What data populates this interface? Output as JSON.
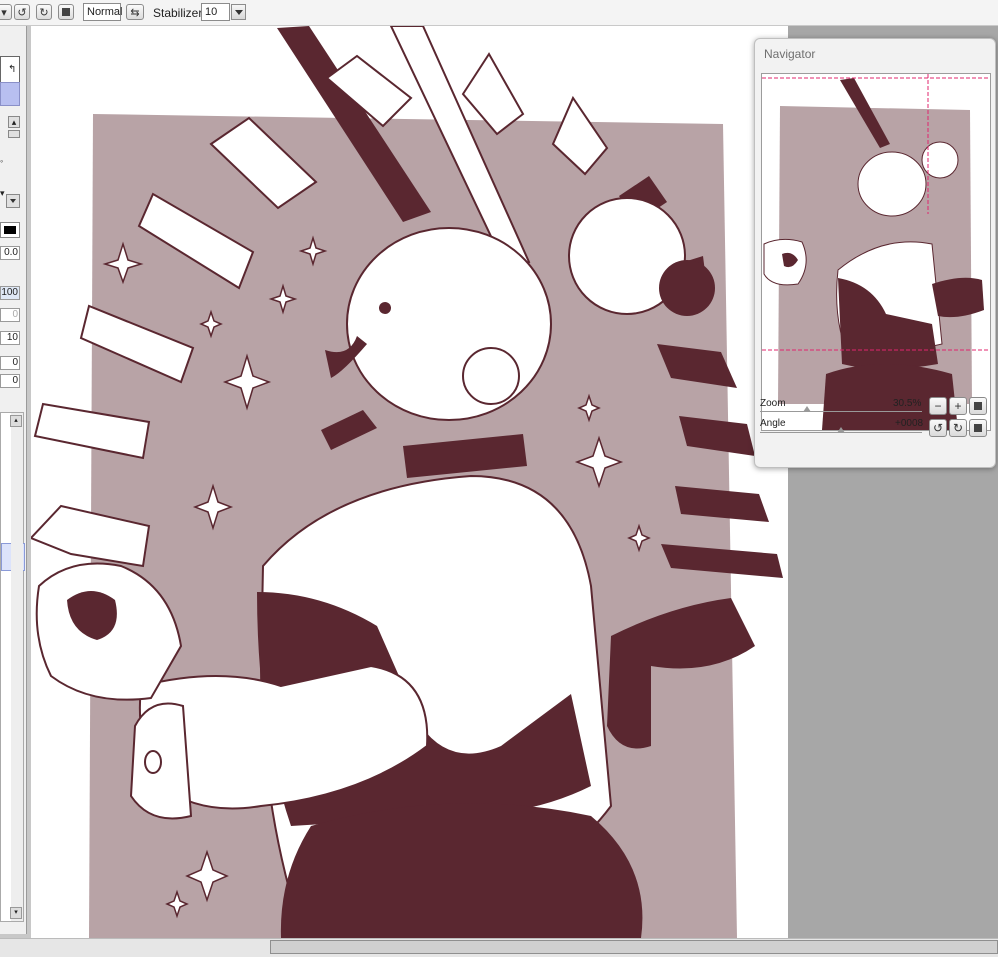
{
  "toolbar": {
    "blend_mode": "Normal",
    "stabilizer_label": "Stabilizer",
    "stabilizer_value": "10"
  },
  "left_panel": {
    "fields": [
      "0.0",
      "100",
      "0",
      "10",
      "0",
      "0"
    ]
  },
  "navigator": {
    "title": "Navigator",
    "zoom_label": "Zoom",
    "zoom_value": "30.5%",
    "angle_label": "Angle",
    "angle_value": "+0008"
  },
  "colors": {
    "ink": "#5a2730",
    "panel_bg": "#b8a3a6",
    "paper": "#ffffff",
    "guide": "#e0246e"
  },
  "icons": [
    "undo-icon",
    "redo-icon",
    "stop-icon",
    "swap-icon",
    "zoom-out-icon",
    "zoom-in-icon",
    "zoom-reset-icon",
    "rotate-left-icon",
    "rotate-right-icon",
    "rotate-reset-icon"
  ]
}
